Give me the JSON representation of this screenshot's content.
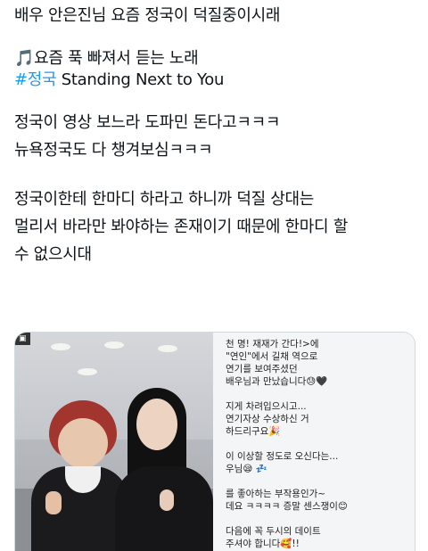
{
  "post": {
    "line1": "배우 안은진님 요즘 정국이 덕질중이시래",
    "music_note": "🎵",
    "line2": "요즘 푹 빠져서 듣는 노래",
    "hashtag": "#정국",
    "song": " Standing Next to You",
    "line3": "정국이 영상 보느라 도파민 돈다고ㅋㅋㅋ",
    "line4": "뉴욕정국도 다 챙겨보심ㅋㅋㅋ",
    "line5": "정국이한테 한마디 하라고 하니까 덕질 상대는",
    "line6": "멀리서 바라만 봐야하는 존재이기 때문에 한마디 할",
    "line7": "수 없으시대"
  },
  "media": {
    "chat_lines": [
      "천 명! 재재가 간다!>에",
      "\"연인\"에서 길채 역으로",
      "연기를 보여주셨던",
      "배우님과 만났습니다😓🖤",
      "",
      "지게 차려입으시고...",
      "연기자상 수상하신 거",
      "하드리구요🎉",
      "",
      "이 이상할 정도로 오신다는...",
      "우님😪 💤",
      "",
      "를 좋아하는 부작용인가~",
      "데요 ㅋㅋㅋㅋ 증말 센스쟁이😊",
      "",
      "다음에 꼭 두시의 데이트",
      "주셔야 합니다🥰!!"
    ]
  },
  "colors": {
    "hashtag": "#1d9bf0",
    "text": "#0f1419"
  }
}
